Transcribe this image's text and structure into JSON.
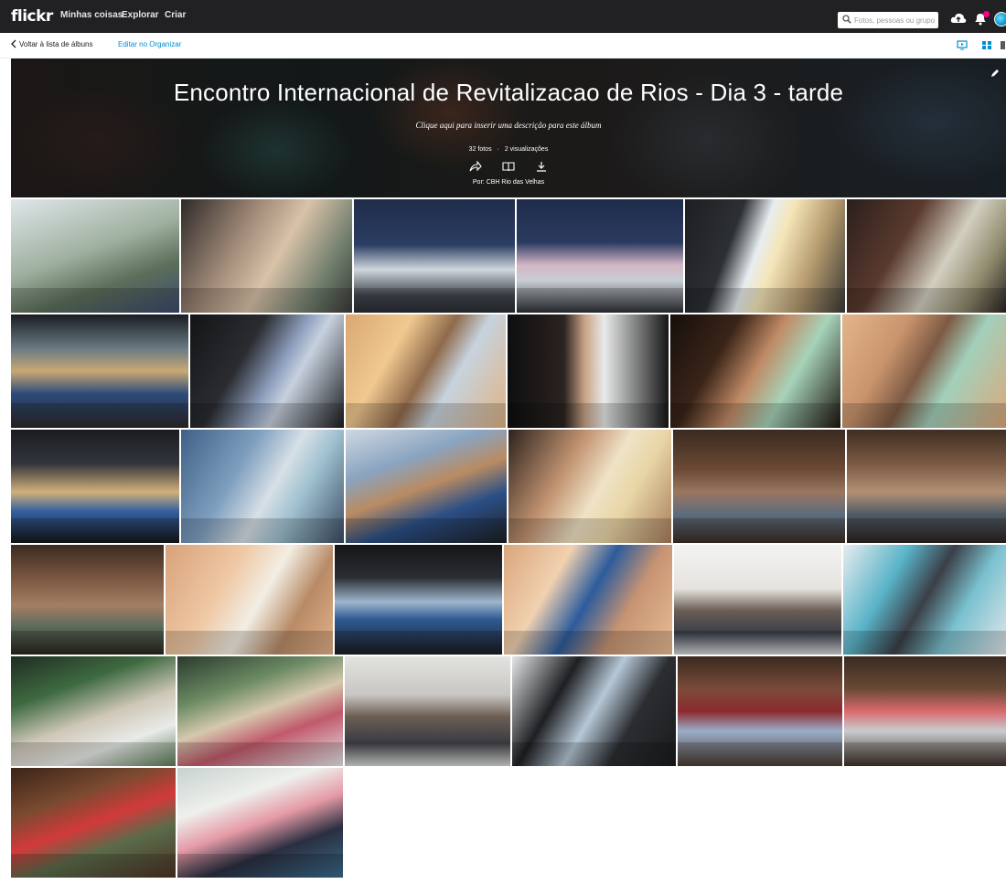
{
  "topbar": {
    "logo": "flickr",
    "nav": [
      "Minhas coisas",
      "Explorar",
      "Criar"
    ],
    "search_placeholder": "Fotos, pessoas ou grupos",
    "icons": [
      "search-icon",
      "upload-cloud-icon",
      "notification-bell-icon",
      "avatar"
    ],
    "colors": {
      "bar": "#212124",
      "notification": "#ff0084"
    }
  },
  "subbar": {
    "back_label": "Voltar à lista de álbuns",
    "edit_label": "Editar no Organizar",
    "icons": [
      "slideshow-icon",
      "grid-view-icon",
      "list-view-icon"
    ],
    "accent": "#008ecf"
  },
  "album": {
    "title": "Encontro Internacional de Revitalizacao de Rios - Dia 3 - tarde",
    "description_prompt": "Clique aqui para inserir uma descrição para este álbum",
    "photo_count": "32 fotos",
    "separator": "·",
    "views": "2 visualizações",
    "actions": [
      "share-icon",
      "book-icon",
      "download-icon"
    ],
    "byline": "Por: CBH Rio das Velhas"
  },
  "photos": [
    {
      "subject": "hall-plants"
    },
    {
      "subject": "three-participants"
    },
    {
      "subject": "group-of-men"
    },
    {
      "subject": "group-with-women"
    },
    {
      "subject": "speaker-with-slide"
    },
    {
      "subject": "speaker-tie"
    },
    {
      "subject": "stage-wide"
    },
    {
      "subject": "speaker-dark"
    },
    {
      "subject": "speaker-warm"
    },
    {
      "subject": "speaker-podium"
    },
    {
      "subject": "speaker-green-shirt"
    },
    {
      "subject": "speaker-green-shirt-2"
    },
    {
      "subject": "stage-speaker"
    },
    {
      "subject": "speaker-logo-banner"
    },
    {
      "subject": "stage-audience"
    },
    {
      "subject": "woman-speaker"
    },
    {
      "subject": "audience-1"
    },
    {
      "subject": "audience-2"
    },
    {
      "subject": "audience-clapping"
    },
    {
      "subject": "woman-speaker-2"
    },
    {
      "subject": "stage-group"
    },
    {
      "subject": "speaker-blue-shirt"
    },
    {
      "subject": "group-photo-white"
    },
    {
      "subject": "two-men-table"
    },
    {
      "subject": "two-men-green"
    },
    {
      "subject": "installation"
    },
    {
      "subject": "three-people"
    },
    {
      "subject": "speaker-slide-2"
    },
    {
      "subject": "couple-seated"
    },
    {
      "subject": "seated-group"
    },
    {
      "subject": "three-seated"
    },
    {
      "subject": "group-banner"
    }
  ]
}
